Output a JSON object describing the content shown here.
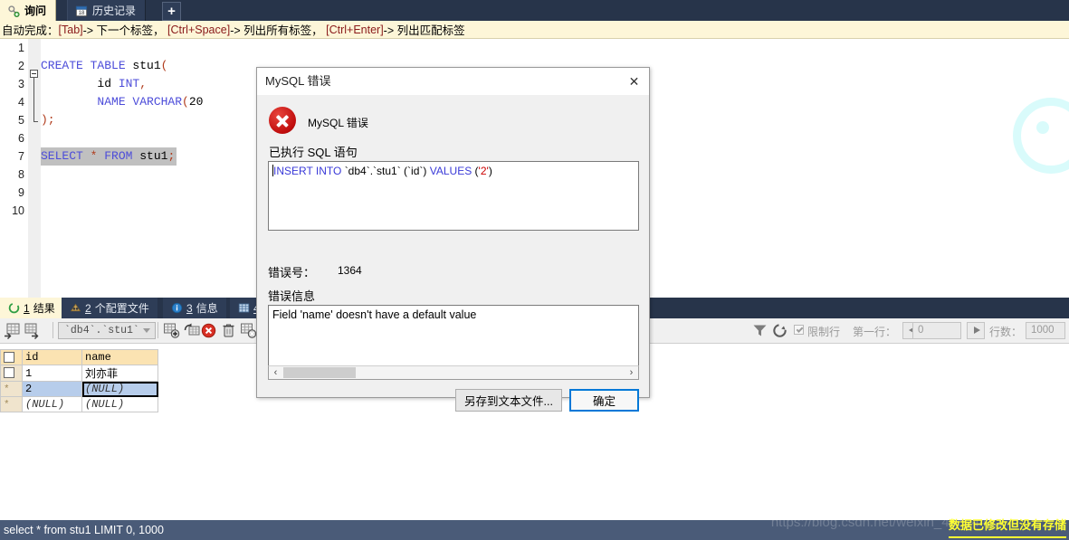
{
  "tabs": [
    {
      "label": "询问",
      "icon": "key-icon",
      "active": true
    },
    {
      "label": "历史记录",
      "icon": "calendar-icon",
      "active": false
    }
  ],
  "new_tab_label": "+",
  "hint_bar": {
    "prefix": "自动完成：",
    "items": [
      {
        "key": "[Tab]",
        "text": "-> 下一个标签，"
      },
      {
        "key": "[Ctrl+Space]",
        "text": "-> 列出所有标签，"
      },
      {
        "key": "[Ctrl+Enter]",
        "text": "-> 列出匹配标签"
      }
    ]
  },
  "editor": {
    "line_numbers": [
      "1",
      "2",
      "3",
      "4",
      "5",
      "6",
      "7",
      "8",
      "9",
      "10"
    ],
    "lines": [
      {
        "n": 1,
        "tokens": []
      },
      {
        "n": 2,
        "tokens": [
          {
            "t": "CREATE TABLE ",
            "c": "kw"
          },
          {
            "t": "stu1",
            "c": "tx"
          },
          {
            "t": "(",
            "c": "pn"
          }
        ]
      },
      {
        "n": 3,
        "tokens": [
          {
            "t": "        id ",
            "c": "tx"
          },
          {
            "t": "INT",
            "c": "kw"
          },
          {
            "t": ",",
            "c": "pn"
          }
        ]
      },
      {
        "n": 4,
        "tokens": [
          {
            "t": "        ",
            "c": "tx"
          },
          {
            "t": "NAME VARCHAR",
            "c": "kw"
          },
          {
            "t": "(",
            "c": "pn"
          },
          {
            "t": "20",
            "c": "tx"
          }
        ]
      },
      {
        "n": 5,
        "tokens": [
          {
            "t": ");",
            "c": "pn"
          }
        ]
      },
      {
        "n": 6,
        "tokens": []
      },
      {
        "n": 7,
        "selected": true,
        "tokens": [
          {
            "t": "SELECT ",
            "c": "kw"
          },
          {
            "t": "*",
            "c": "pn"
          },
          {
            "t": " FROM ",
            "c": "kw"
          },
          {
            "t": "stu1",
            "c": "tx"
          },
          {
            "t": ";",
            "c": "pn"
          }
        ]
      },
      {
        "n": 8,
        "tokens": []
      },
      {
        "n": 9,
        "tokens": []
      },
      {
        "n": 10,
        "tokens": []
      }
    ]
  },
  "result_tabs": [
    {
      "num": "1",
      "label": "结果",
      "icon": "result-icon",
      "active": true
    },
    {
      "num": "2",
      "label": "个配置文件",
      "icon": "profile-icon",
      "active": false
    },
    {
      "num": "3",
      "label": "信息",
      "icon": "info-icon",
      "active": false
    },
    {
      "num": "4",
      "label": "",
      "icon": "table-icon",
      "active": false
    }
  ],
  "result_toolbar": {
    "table_select_value": "`db4`.`stu1`",
    "limit_checkbox_label": "限制行",
    "first_row_label": "第一行：",
    "first_row_value": "0",
    "row_count_label": "行数：",
    "row_count_value": "1000"
  },
  "grid": {
    "columns": [
      "id",
      "name"
    ],
    "rows": [
      {
        "mark": "box",
        "selected": false,
        "id": "1",
        "name": "刘亦菲",
        "focus": false
      },
      {
        "mark": "star",
        "selected": true,
        "id": "2",
        "name": "(NULL)",
        "focus": true
      },
      {
        "mark": "star",
        "selected": false,
        "id": "(NULL)",
        "name": "(NULL)",
        "focus": false
      }
    ]
  },
  "dialog": {
    "title": "MySQL 错误",
    "close_label": "✕",
    "error_heading": "MySQL 错误",
    "executed_sql_label": "已执行 SQL 语句",
    "sql_tokens": [
      {
        "t": "INSERT INTO ",
        "c": "kw"
      },
      {
        "t": "`db4`.`stu1` ",
        "c": "id"
      },
      {
        "t": "(",
        "c": "paren"
      },
      {
        "t": "`id`",
        "c": "id"
      },
      {
        "t": ") ",
        "c": "paren"
      },
      {
        "t": "VALUES ",
        "c": "kw"
      },
      {
        "t": "(",
        "c": "paren"
      },
      {
        "t": "'2'",
        "c": "str"
      },
      {
        "t": ")",
        "c": "paren"
      }
    ],
    "error_no_label": "错误号：",
    "error_no_value": "1364",
    "error_info_label": "错误信息",
    "error_message": "Field 'name' doesn't have a default value",
    "scroll_left_label": "‹",
    "scroll_right_label": "›",
    "save_button": "另存到文本文件...",
    "ok_button": "确定"
  },
  "status_bar": {
    "query": "select * from stu1 LIMIT 0, 1000"
  },
  "watermark": {
    "url": "https://blog.csdn.net/weixin_44604432",
    "annotation": "数据已修改但没有存储"
  },
  "colors": {
    "tab_active_bg": "#fdf6d8",
    "tab_bar_bg": "#27344a",
    "status_bar_bg": "#4a5b78",
    "accent_blue": "#0078d7",
    "error_red": "#c00d0d",
    "annotation_yellow": "#ffff33",
    "grid_header": "#fbe3b2",
    "row_selected": "#b7cdeb"
  }
}
